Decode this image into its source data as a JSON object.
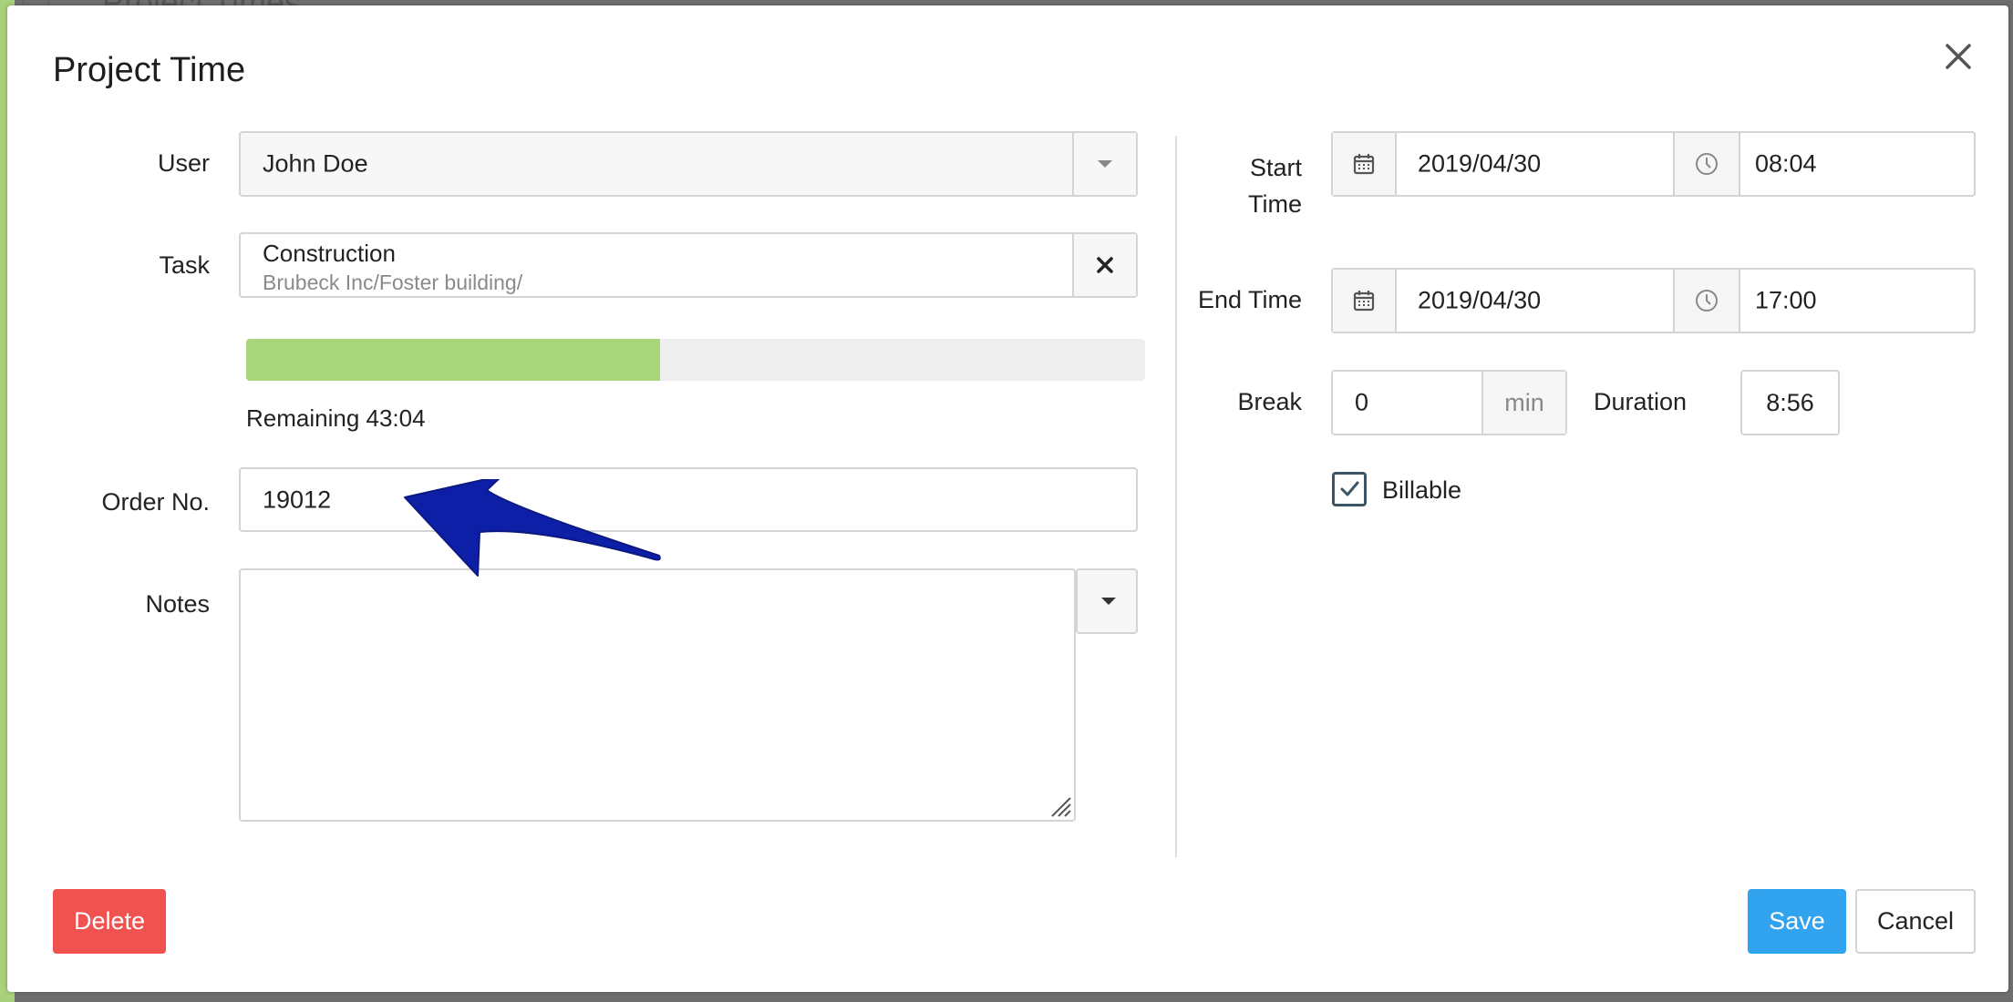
{
  "background": {
    "title": "Project Times"
  },
  "dialog": {
    "title": "Project Time",
    "labels": {
      "user": "User",
      "task": "Task",
      "order_no": "Order No.",
      "notes": "Notes",
      "start_time": "Start Time",
      "end_time": "End Time",
      "break": "Break",
      "duration": "Duration"
    },
    "user": {
      "value": "John Doe"
    },
    "task": {
      "name": "Construction",
      "path": "Brubeck Inc/Foster building/"
    },
    "progress": {
      "fraction": 0.46,
      "remaining_text": "Remaining 43:04"
    },
    "order_no": {
      "value": "19012"
    },
    "notes": {
      "value": ""
    },
    "start": {
      "date": "2019/04/30",
      "time": "08:04"
    },
    "end": {
      "date": "2019/04/30",
      "time": "17:00"
    },
    "break": {
      "value": "0",
      "unit": "min"
    },
    "duration": {
      "value": "8:56"
    },
    "billable": {
      "label": "Billable",
      "checked": true
    },
    "buttons": {
      "delete": "Delete",
      "save": "Save",
      "cancel": "Cancel"
    }
  },
  "colors": {
    "delete": "#f0524f",
    "save": "#32a4ef",
    "progress_fill": "#a9d67b",
    "annotation_arrow": "#0d1fa6"
  },
  "icons": [
    "close-icon",
    "chevron-down-icon",
    "clear-icon",
    "calendar-icon",
    "clock-icon",
    "check-icon",
    "resize-handle-icon",
    "annotation-arrow-icon"
  ]
}
